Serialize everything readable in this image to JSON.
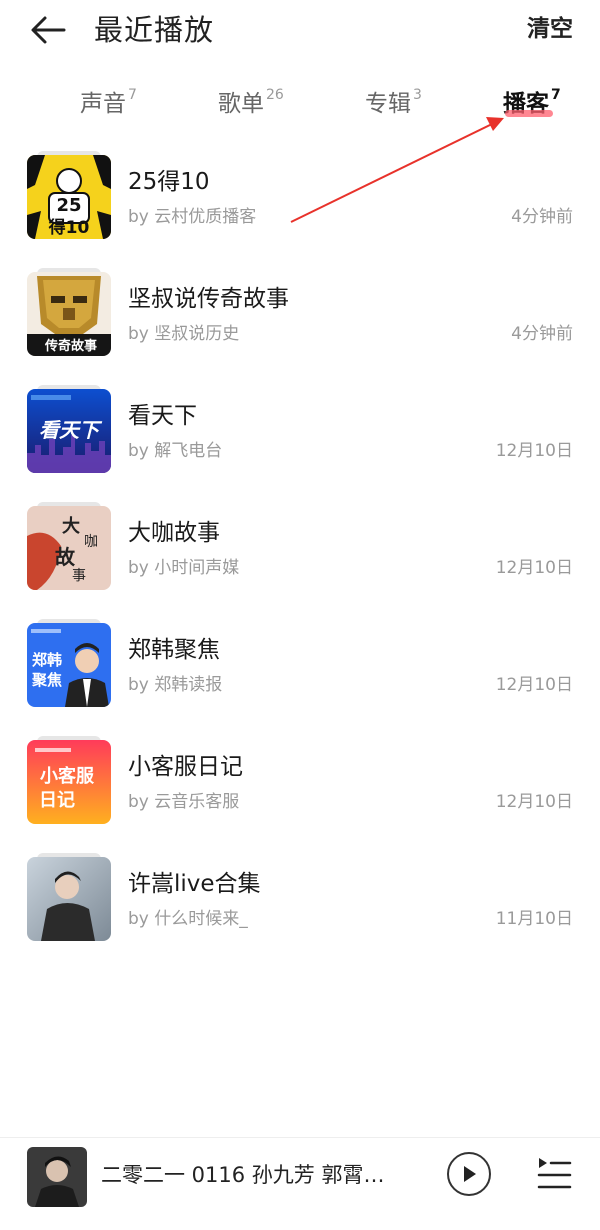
{
  "header": {
    "title": "最近播放",
    "clear_label": "清空"
  },
  "tabs": [
    {
      "label": "声音",
      "count": "7",
      "active": false
    },
    {
      "label": "歌单",
      "count": "26",
      "active": false
    },
    {
      "label": "专辑",
      "count": "3",
      "active": false
    },
    {
      "label": "播客",
      "count": "7",
      "active": true
    }
  ],
  "colors": {
    "accent": "#ff3a3a",
    "annotation": "#e8322b",
    "muted_text": "#9a9a9a"
  },
  "list": [
    {
      "title": "25得10",
      "by": "by 云村优质播客",
      "time": "4分钟前",
      "cover_text": [
        "25",
        "得10"
      ],
      "cover_icon": "cover-25de10"
    },
    {
      "title": "坚叔说传奇故事",
      "by": "by 坚叔说历史",
      "time": "4分钟前",
      "cover_text": [
        "传奇故事"
      ],
      "cover_icon": "cover-bronze-mask"
    },
    {
      "title": "看天下",
      "by": "by 解飞电台",
      "time": "12月10日",
      "cover_text": [
        "看天下"
      ],
      "cover_icon": "cover-city-night"
    },
    {
      "title": "大咖故事",
      "by": "by 小时间声媒",
      "time": "12月10日",
      "cover_text": [
        "大",
        "咖",
        "故",
        "事"
      ],
      "cover_icon": "cover-calligraphy"
    },
    {
      "title": "郑韩聚焦",
      "by": "by 郑韩读报",
      "time": "12月10日",
      "cover_text": [
        "郑韩",
        "聚焦"
      ],
      "cover_icon": "cover-portrait-blue"
    },
    {
      "title": "小客服日记",
      "by": "by 云音乐客服",
      "time": "12月10日",
      "cover_text": [
        "小客服",
        "日记"
      ],
      "cover_icon": "cover-orange-gradient"
    },
    {
      "title": "许嵩live合集",
      "by": "by 什么时候来_",
      "time": "11月10日",
      "cover_text": [],
      "cover_icon": "cover-photo-portrait"
    }
  ],
  "player": {
    "now_playing": "二零二一 0116 孙九芳 郭霄…"
  }
}
